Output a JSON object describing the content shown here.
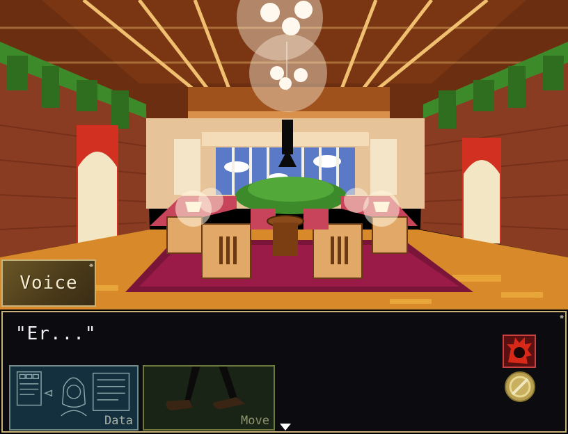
{
  "scene": {
    "location": "lounge hall"
  },
  "speaker": {
    "name": "Voice"
  },
  "dialogue": {
    "text": "\"Er...\""
  },
  "actions": {
    "data_label": "Data",
    "move_label": "Move"
  },
  "colors": {
    "frame_border": "#c9b27a",
    "dialogue_bg": "#0b0b10",
    "speaker_bg": "#4a3a1a",
    "carpet": "#7a1438",
    "brick": "#8a3c22",
    "ivy": "#3d8a2a",
    "accent_red": "#c8201e"
  },
  "icons": {
    "portrait": "spiky-red-hair-portrait-icon",
    "coin": "gold-coin-icon",
    "advance": "triangle-down-icon"
  }
}
